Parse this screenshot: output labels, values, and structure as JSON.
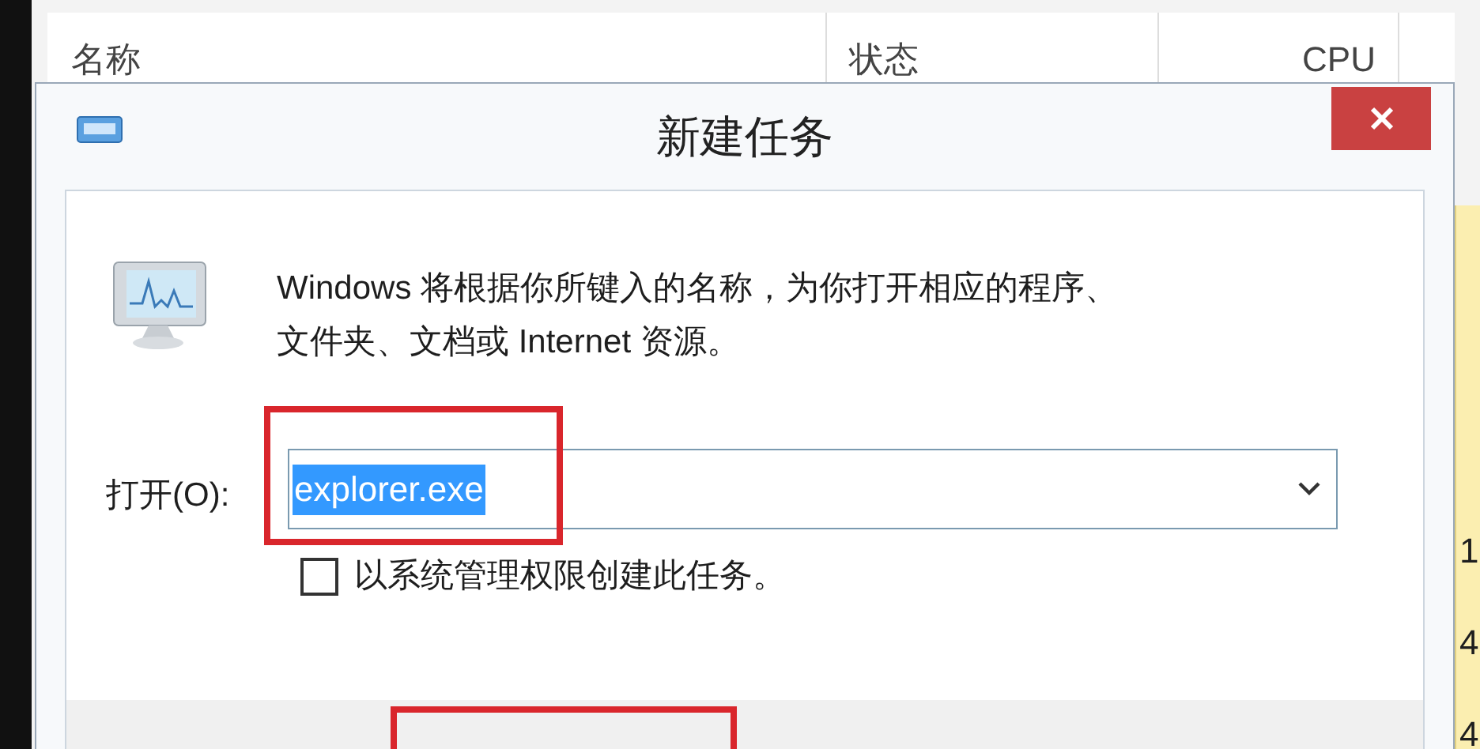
{
  "background_table": {
    "columns": [
      "名称",
      "状态",
      "CPU"
    ],
    "cpu_cells": [
      "1",
      "4",
      "4"
    ]
  },
  "dialog": {
    "title": "新建任务",
    "message_lines": [
      "Windows 将根据你所键入的名称，为你打开相应的程序、",
      "文件夹、文档或 Internet 资源。"
    ],
    "open_label": "打开(O):",
    "input": {
      "value": "explorer.exe",
      "selected": true
    },
    "admin_checkbox": {
      "label": "以系统管理权限创建此任务。",
      "checked": false
    }
  }
}
